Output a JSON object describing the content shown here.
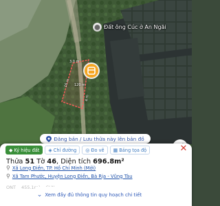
{
  "map": {
    "poi_label": "Đất ông Cúc ở An Ngãi",
    "plot_edge_labels": [
      "3.0 m",
      "120 m",
      "16 m",
      "4 m"
    ],
    "marker_icon": "plot-marker-icon",
    "colors": {
      "accent": "#f5a623",
      "plot_outline": "#ff5a5a",
      "marker_bg": "#2c4fa3"
    }
  },
  "action_bar": {
    "label": "Đăng bản / Lưu thửa này lên bản đồ",
    "icon": "location-pin-icon"
  },
  "panel": {
    "tabs": [
      {
        "label": "Ký hiệu đất",
        "icon": "tag-icon",
        "active": true
      },
      {
        "label": "Chỉ đường",
        "icon": "directions-icon",
        "active": false
      },
      {
        "label": "Đo vẽ",
        "icon": "measure-icon",
        "active": false
      },
      {
        "label": "Bảng tọa độ",
        "icon": "table-icon",
        "active": false
      }
    ],
    "title": {
      "prefix": "Thửa ",
      "plot_number": "51",
      "mid": " Tờ ",
      "sheet_number": "46",
      "area_prefix": ", Diện tích ",
      "area": "696.8m²"
    },
    "address_new": "Xã Long Điền, TP. Hồ Chí Minh (Mới)",
    "address_old": "Xã Tam Phước, Huyện Long Điền, Bà Rịa - Vũng Tàu",
    "faded_row": [
      "ONT",
      "455.1m²",
      "CLN"
    ],
    "more_button": "Xem đầy đủ thông tin quy hoạch chi tiết"
  }
}
